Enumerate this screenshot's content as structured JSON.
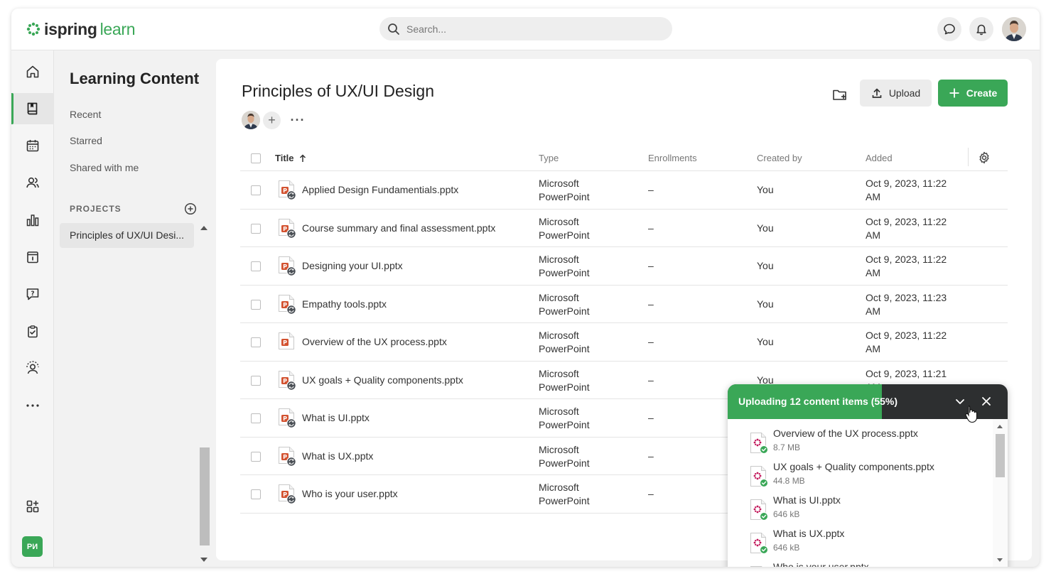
{
  "app": {
    "logo_primary": "ispring",
    "logo_secondary": "learn",
    "brand_color": "#3aa757"
  },
  "header": {
    "search_placeholder": "Search...",
    "icons": [
      "chat-icon",
      "bell-icon",
      "user-avatar"
    ]
  },
  "rail": {
    "items": [
      "home-icon",
      "book-icon",
      "calendar-icon",
      "users-icon",
      "chart-icon",
      "info-calendar-icon",
      "question-icon",
      "clipboard-check-icon",
      "user-gear-icon",
      "more-icon"
    ],
    "active": "book-icon",
    "apps_icon": "apps-add-icon",
    "badge": "РИ"
  },
  "leftnav": {
    "title": "Learning Content",
    "links": [
      "Recent",
      "Starred",
      "Shared with me"
    ],
    "projects_label": "PROJECTS",
    "projects": [
      "Principles of UX/UI Desi..."
    ]
  },
  "main": {
    "title": "Principles of UX/UI Design",
    "upload_label": "Upload",
    "create_label": "Create",
    "columns": {
      "title": "Title",
      "type": "Type",
      "enrollments": "Enrollments",
      "created_by": "Created by",
      "added": "Added"
    },
    "rows": [
      {
        "name": "Applied Design Fundamentials.pptx",
        "type1": "Microsoft",
        "type2": "PowerPoint",
        "enrollments": "–",
        "created_by": "You",
        "added1": "Oct 9, 2023, 11:22",
        "added2": "AM"
      },
      {
        "name": "Course summary and final assessment.pptx",
        "type1": "Microsoft",
        "type2": "PowerPoint",
        "enrollments": "–",
        "created_by": "You",
        "added1": "Oct 9, 2023, 11:22",
        "added2": "AM"
      },
      {
        "name": "Designing your UI.pptx",
        "type1": "Microsoft",
        "type2": "PowerPoint",
        "enrollments": "–",
        "created_by": "You",
        "added1": "Oct 9, 2023, 11:22",
        "added2": "AM"
      },
      {
        "name": "Empathy tools.pptx",
        "type1": "Microsoft",
        "type2": "PowerPoint",
        "enrollments": "–",
        "created_by": "You",
        "added1": "Oct 9, 2023, 11:23",
        "added2": "AM"
      },
      {
        "name": "Overview of the UX process.pptx",
        "type1": "Microsoft",
        "type2": "PowerPoint",
        "enrollments": "–",
        "created_by": "You",
        "added1": "Oct 9, 2023, 11:22",
        "added2": "AM"
      },
      {
        "name": "UX goals + Quality components.pptx",
        "type1": "Microsoft",
        "type2": "PowerPoint",
        "enrollments": "–",
        "created_by": "You",
        "added1": "Oct 9, 2023, 11:21",
        "added2": "AM"
      },
      {
        "name": "What is UI.pptx",
        "type1": "Microsoft",
        "type2": "PowerPoint",
        "enrollments": "–",
        "created_by": "",
        "added1": "",
        "added2": ""
      },
      {
        "name": "What is UX.pptx",
        "type1": "Microsoft",
        "type2": "PowerPoint",
        "enrollments": "–",
        "created_by": "",
        "added1": "",
        "added2": ""
      },
      {
        "name": "Who is your user.pptx",
        "type1": "Microsoft",
        "type2": "PowerPoint",
        "enrollments": "–",
        "created_by": "",
        "added1": "",
        "added2": ""
      }
    ]
  },
  "upload_panel": {
    "title": "Uploading 12 content items (55%)",
    "progress": 0.55,
    "items": [
      {
        "name": "Overview of the UX process.pptx",
        "size": "8.7 MB"
      },
      {
        "name": "UX goals + Quality components.pptx",
        "size": "44.8 MB"
      },
      {
        "name": "What is UI.pptx",
        "size": "646 kB"
      },
      {
        "name": "What is UX.pptx",
        "size": "646 kB"
      },
      {
        "name": "Who is your user.pptx",
        "size": ""
      }
    ]
  }
}
